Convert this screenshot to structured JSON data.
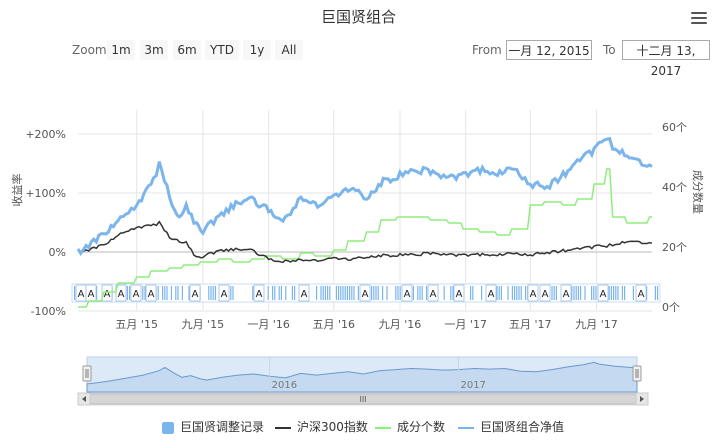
{
  "title": "巨国贤组合",
  "menu_icon": "hamburger-menu-icon",
  "range_selector": {
    "zoom_label": "Zoom",
    "buttons": [
      "1m",
      "3m",
      "6m",
      "YTD",
      "1y",
      "All"
    ],
    "from_label": "From",
    "from_value": "一月 12, 2015",
    "to_label": "To",
    "to_value": "十二月 13, 2017"
  },
  "legend": [
    {
      "name": "巨国贤调整记录",
      "color": "#7cb5ec",
      "symbol": "square"
    },
    {
      "name": "沪深300指数",
      "color": "#333333",
      "symbol": "line"
    },
    {
      "name": "成分个数",
      "color": "#90ed7d",
      "symbol": "line"
    },
    {
      "name": "巨国贤组合净值",
      "color": "#7cb5ec",
      "symbol": "line"
    }
  ],
  "navigator": {
    "year_labels": [
      "2016",
      "2017"
    ],
    "scrollbar_grip": "III"
  },
  "chart_data": {
    "type": "line",
    "x_range": [
      "2015-01-12",
      "2017-12-13"
    ],
    "x_tick_labels": [
      "五月 '15",
      "九月 '15",
      "一月 '16",
      "五月 '16",
      "九月 '16",
      "一月 '17",
      "五月 '17",
      "九月 '17"
    ],
    "y_left": {
      "label": "收益率",
      "ticks": [
        "+200%",
        "+100%",
        "0%",
        "-100%"
      ],
      "range": [
        -100,
        200
      ]
    },
    "y_right": {
      "label": "成分数量",
      "ticks": [
        "60个",
        "40个",
        "20个",
        "0个"
      ],
      "range": [
        0,
        60
      ]
    },
    "flags_text": "A",
    "series": [
      {
        "name": "巨国贤组合净值",
        "axis": "left",
        "color": "#7cb5ec",
        "x": [
          "2015-01-12",
          "2015-02-01",
          "2015-03-01",
          "2015-04-01",
          "2015-05-01",
          "2015-06-01",
          "2015-06-12",
          "2015-07-01",
          "2015-07-15",
          "2015-08-01",
          "2015-08-20",
          "2015-09-01",
          "2015-10-01",
          "2015-11-01",
          "2015-12-01",
          "2016-01-01",
          "2016-02-01",
          "2016-03-01",
          "2016-04-01",
          "2016-05-01",
          "2016-06-01",
          "2016-07-01",
          "2016-08-01",
          "2016-09-01",
          "2016-10-01",
          "2016-11-01",
          "2016-12-01",
          "2017-01-01",
          "2017-02-01",
          "2017-03-01",
          "2017-04-01",
          "2017-05-01",
          "2017-06-01",
          "2017-07-01",
          "2017-08-01",
          "2017-09-01",
          "2017-09-20",
          "2017-10-01",
          "2017-11-01",
          "2017-12-13"
        ],
        "values": [
          0,
          10,
          30,
          55,
          80,
          120,
          150,
          95,
          60,
          75,
          45,
          35,
          60,
          80,
          90,
          70,
          55,
          95,
          80,
          95,
          110,
          90,
          120,
          130,
          140,
          135,
          125,
          130,
          140,
          135,
          140,
          115,
          110,
          130,
          155,
          175,
          195,
          180,
          160,
          145
        ]
      },
      {
        "name": "沪深300指数",
        "axis": "left",
        "color": "#333333",
        "x": [
          "2015-01-12",
          "2015-02-01",
          "2015-03-01",
          "2015-04-01",
          "2015-05-01",
          "2015-06-01",
          "2015-06-12",
          "2015-07-01",
          "2015-07-15",
          "2015-08-01",
          "2015-08-20",
          "2015-09-01",
          "2015-10-01",
          "2015-11-01",
          "2015-12-01",
          "2016-01-01",
          "2016-02-01",
          "2016-03-01",
          "2016-04-01",
          "2016-05-01",
          "2016-06-01",
          "2016-07-01",
          "2016-08-01",
          "2016-09-01",
          "2016-10-01",
          "2016-11-01",
          "2016-12-01",
          "2017-01-01",
          "2017-02-01",
          "2017-03-01",
          "2017-04-01",
          "2017-05-01",
          "2017-06-01",
          "2017-07-01",
          "2017-08-01",
          "2017-09-01",
          "2017-09-20",
          "2017-10-01",
          "2017-11-01",
          "2017-12-13"
        ],
        "values": [
          0,
          3,
          12,
          30,
          42,
          45,
          50,
          25,
          20,
          15,
          -10,
          -8,
          2,
          4,
          3,
          -12,
          -16,
          -12,
          -14,
          -10,
          -12,
          -9,
          -6,
          -5,
          -4,
          -2,
          -5,
          -6,
          -4,
          -4,
          -3,
          -5,
          -1,
          2,
          5,
          9,
          10,
          13,
          18,
          15
        ]
      },
      {
        "name": "成分个数",
        "axis": "right",
        "color": "#90ed7d",
        "x": [
          "2015-01-12",
          "2015-02-01",
          "2015-03-01",
          "2015-04-01",
          "2015-05-01",
          "2015-06-01",
          "2015-07-01",
          "2015-08-01",
          "2015-09-01",
          "2015-10-01",
          "2015-11-01",
          "2015-12-01",
          "2016-01-01",
          "2016-02-01",
          "2016-03-01",
          "2016-04-01",
          "2016-05-01",
          "2016-06-01",
          "2016-07-01",
          "2016-08-01",
          "2016-09-01",
          "2016-10-01",
          "2016-11-01",
          "2016-12-01",
          "2017-01-01",
          "2017-02-01",
          "2017-03-01",
          "2017-04-01",
          "2017-05-01",
          "2017-06-01",
          "2017-07-01",
          "2017-08-01",
          "2017-09-01",
          "2017-09-20",
          "2017-10-01",
          "2017-11-01",
          "2017-12-13"
        ],
        "values": [
          0,
          2,
          5,
          8,
          10,
          12,
          13,
          14,
          15,
          16,
          15,
          16,
          17,
          16,
          18,
          17,
          19,
          22,
          25,
          29,
          30,
          30,
          29,
          28,
          26,
          25,
          24,
          26,
          34,
          35,
          34,
          36,
          41,
          46,
          30,
          28,
          30
        ]
      }
    ],
    "adjustment_records": {
      "name": "巨国贤调整记录",
      "color": "#7cb5ec"
    }
  }
}
